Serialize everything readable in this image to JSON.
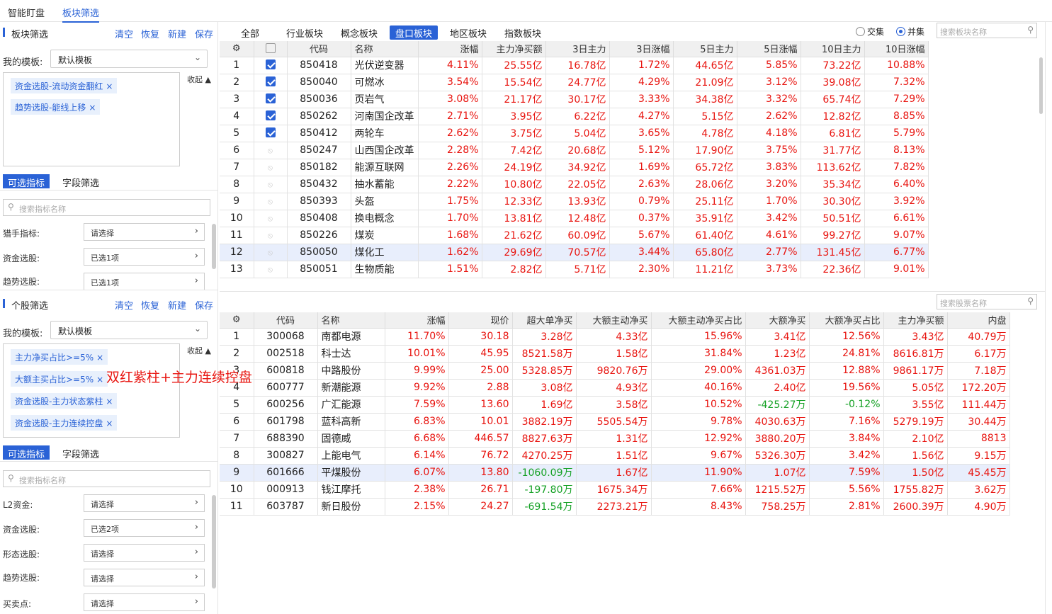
{
  "top_tabs": [
    "智能盯盘",
    "板块筛选"
  ],
  "block_filter": {
    "title": "板块筛选",
    "actions": [
      "清空",
      "恢复",
      "新建",
      "保存"
    ],
    "template_label": "我的模板:",
    "template_value": "默认模板",
    "tags": [
      "资金选股-流动资金翻红",
      "趋势选股-能线上移"
    ],
    "collapse": "收起",
    "tabs": [
      "可选指标",
      "字段筛选"
    ],
    "search_placeholder": "搜索指标名称",
    "indicators": [
      {
        "label": "猎手指标:",
        "value": "请选择"
      },
      {
        "label": "资金选股:",
        "value": "已选1项"
      },
      {
        "label": "趋势选股:",
        "value": "已选1项"
      }
    ]
  },
  "stock_filter": {
    "title": "个股筛选",
    "actions": [
      "清空",
      "恢复",
      "新建",
      "保存"
    ],
    "template_label": "我的模板:",
    "template_value": "默认模板",
    "tags": [
      "主力净买占比>=5%",
      "大额主买占比>=5%",
      "资金选股-主力状态紫柱",
      "资金选股-主力连续控盘"
    ],
    "collapse": "收起",
    "tabs": [
      "可选指标",
      "字段筛选"
    ],
    "search_placeholder": "搜索指标名称",
    "indicators": [
      {
        "label": "L2资金:",
        "value": "请选择"
      },
      {
        "label": "资金选股:",
        "value": "已选2项"
      },
      {
        "label": "形态选股:",
        "value": "请选择"
      },
      {
        "label": "趋势选股:",
        "value": "请选择"
      },
      {
        "label": "买卖点:",
        "value": "请选择"
      }
    ]
  },
  "overlay_text": "双红紫柱+主力连续控盘",
  "category_tabs": [
    "全部",
    "行业板块",
    "概念板块",
    "盘口板块",
    "地区板块",
    "指数板块"
  ],
  "radios": [
    {
      "label": "交集",
      "checked": false
    },
    {
      "label": "并集",
      "checked": true
    }
  ],
  "block_search_placeholder": "搜索板块名称",
  "stock_search_placeholder": "搜索股票名称",
  "block_table": {
    "headers": [
      "",
      "代码",
      "名称",
      "涨幅",
      "主力净买额",
      "3日主力",
      "3日涨幅",
      "5日主力",
      "5日涨幅",
      "10日主力",
      "10日涨幅"
    ],
    "rows": [
      [
        "1",
        true,
        "850418",
        "光伏逆变器",
        "4.11%",
        "25.55亿",
        "16.78亿",
        "1.72%",
        "44.65亿",
        "5.85%",
        "73.22亿",
        "10.88%"
      ],
      [
        "2",
        true,
        "850040",
        "可燃冰",
        "3.54%",
        "15.54亿",
        "24.77亿",
        "4.29%",
        "21.09亿",
        "3.12%",
        "39.08亿",
        "7.32%"
      ],
      [
        "3",
        true,
        "850036",
        "页岩气",
        "3.08%",
        "21.17亿",
        "30.17亿",
        "3.33%",
        "34.38亿",
        "3.32%",
        "65.74亿",
        "7.29%"
      ],
      [
        "4",
        true,
        "850262",
        "河南国企改革",
        "2.71%",
        "3.95亿",
        "6.22亿",
        "4.27%",
        "5.15亿",
        "2.62%",
        "12.82亿",
        "8.85%"
      ],
      [
        "5",
        true,
        "850412",
        "两轮车",
        "2.62%",
        "3.75亿",
        "5.04亿",
        "3.65%",
        "4.78亿",
        "4.18%",
        "6.81亿",
        "5.79%"
      ],
      [
        "6",
        false,
        "850247",
        "山西国企改革",
        "2.28%",
        "7.42亿",
        "20.68亿",
        "5.12%",
        "17.90亿",
        "3.75%",
        "31.77亿",
        "8.13%"
      ],
      [
        "7",
        false,
        "850182",
        "能源互联网",
        "2.26%",
        "24.19亿",
        "34.92亿",
        "1.69%",
        "65.72亿",
        "3.83%",
        "113.62亿",
        "7.82%"
      ],
      [
        "8",
        false,
        "850432",
        "抽水蓄能",
        "2.22%",
        "10.80亿",
        "22.05亿",
        "2.63%",
        "28.06亿",
        "3.20%",
        "35.34亿",
        "6.40%"
      ],
      [
        "9",
        false,
        "850393",
        "头盔",
        "1.75%",
        "12.33亿",
        "13.93亿",
        "0.79%",
        "25.11亿",
        "1.70%",
        "30.30亿",
        "3.92%"
      ],
      [
        "10",
        false,
        "850408",
        "换电概念",
        "1.70%",
        "13.81亿",
        "12.48亿",
        "0.37%",
        "35.91亿",
        "3.42%",
        "50.51亿",
        "6.61%"
      ],
      [
        "11",
        false,
        "850226",
        "煤炭",
        "1.68%",
        "21.62亿",
        "60.09亿",
        "5.67%",
        "61.40亿",
        "4.61%",
        "99.27亿",
        "9.07%"
      ],
      [
        "12",
        false,
        "850050",
        "煤化工",
        "1.62%",
        "29.69亿",
        "70.57亿",
        "3.44%",
        "65.80亿",
        "2.77%",
        "131.45亿",
        "6.77%"
      ],
      [
        "13",
        false,
        "850051",
        "生物质能",
        "1.51%",
        "2.82亿",
        "5.71亿",
        "2.30%",
        "11.21亿",
        "3.73%",
        "22.36亿",
        "9.01%"
      ]
    ]
  },
  "stock_table": {
    "headers": [
      "代码",
      "名称",
      "涨幅",
      "现价",
      "超大单净买",
      "大额主动净买",
      "大额主动净买占比",
      "大额净买",
      "大额净买占比",
      "主力净买额",
      "内盘"
    ],
    "rows": [
      [
        "1",
        "300068",
        "南都电源",
        "11.70%",
        "30.18",
        "3.28亿",
        "4.33亿",
        "15.96%",
        "3.41亿",
        "12.56%",
        "3.43亿",
        "40.79万"
      ],
      [
        "2",
        "002518",
        "科士达",
        "10.01%",
        "45.95",
        "8521.58万",
        "1.58亿",
        "31.84%",
        "1.23亿",
        "24.81%",
        "8616.81万",
        "6.17万"
      ],
      [
        "3",
        "600818",
        "中路股份",
        "9.99%",
        "25.00",
        "5328.85万",
        "9820.76万",
        "29.00%",
        "4361.03万",
        "12.88%",
        "9861.17万",
        "7.18万"
      ],
      [
        "4",
        "600777",
        "新潮能源",
        "9.92%",
        "2.88",
        "3.08亿",
        "4.93亿",
        "40.16%",
        "2.40亿",
        "19.56%",
        "5.05亿",
        "172.20万"
      ],
      [
        "5",
        "600256",
        "广汇能源",
        "7.59%",
        "13.60",
        "1.69亿",
        "3.58亿",
        "10.52%",
        "-425.27万",
        "-0.12%",
        "3.55亿",
        "111.44万"
      ],
      [
        "6",
        "601798",
        "蓝科高新",
        "6.83%",
        "10.01",
        "3882.19万",
        "5505.54万",
        "9.78%",
        "4030.63万",
        "7.16%",
        "5279.19万",
        "30.44万"
      ],
      [
        "7",
        "688390",
        "固德威",
        "6.68%",
        "446.57",
        "8827.63万",
        "1.31亿",
        "12.92%",
        "3880.20万",
        "3.84%",
        "2.10亿",
        "8813"
      ],
      [
        "8",
        "300827",
        "上能电气",
        "6.14%",
        "76.72",
        "4270.25万",
        "1.51亿",
        "9.67%",
        "5326.30万",
        "3.42%",
        "1.56亿",
        "9.15万"
      ],
      [
        "9",
        "601666",
        "平煤股份",
        "6.07%",
        "13.80",
        "-1060.09万",
        "1.67亿",
        "11.90%",
        "1.07亿",
        "7.59%",
        "1.50亿",
        "45.45万"
      ],
      [
        "10",
        "000913",
        "钱江摩托",
        "2.38%",
        "26.71",
        "-197.80万",
        "1675.34万",
        "7.66%",
        "1215.52万",
        "5.56%",
        "1755.82万",
        "3.62万"
      ],
      [
        "11",
        "603787",
        "新日股份",
        "2.15%",
        "24.27",
        "-691.54万",
        "2273.21万",
        "8.43%",
        "758.25万",
        "2.81%",
        "2600.39万",
        "4.90万"
      ]
    ]
  }
}
